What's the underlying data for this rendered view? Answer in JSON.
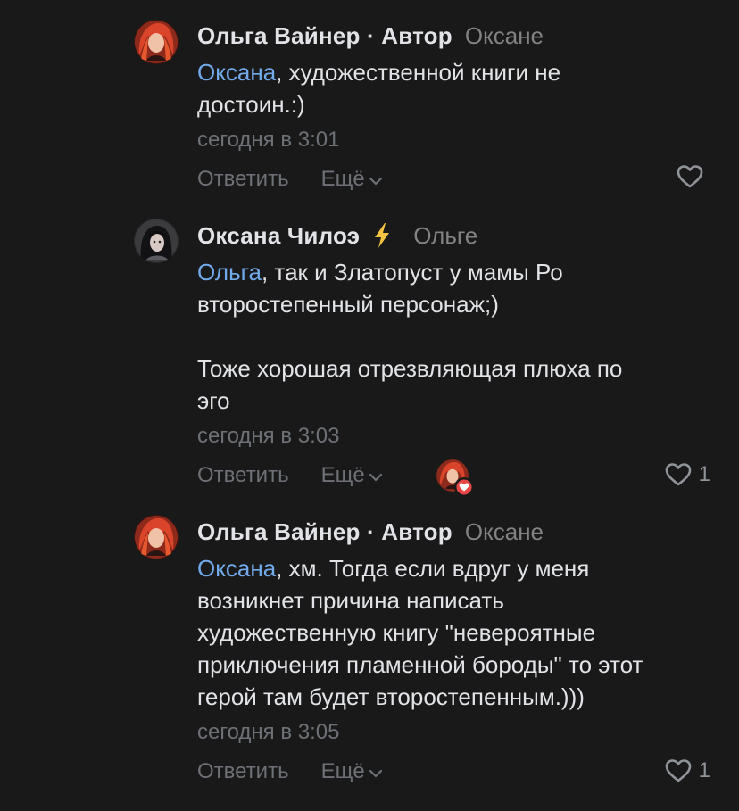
{
  "comments": [
    {
      "author": "Ольга Вайнер · Автор",
      "reply_to": "Оксане",
      "mention": "Оксана",
      "text_lines": [
        ", художественной книги не",
        "достоин.:)"
      ],
      "date": "сегодня в 3:01",
      "reply_label": "Ответить",
      "more_label": "Ещё",
      "likes": ""
    },
    {
      "author": "Оксана Чилоэ",
      "reply_to": "Ольге",
      "mention": "Ольга",
      "text_lines": [
        ", так и Златопуст у мамы Ро",
        "второстепенный персонаж;)"
      ],
      "paragraph2_lines": [
        "Тоже хорошая отрезвляющая плюха по",
        "эго"
      ],
      "date": "сегодня в 3:03",
      "reply_label": "Ответить",
      "more_label": "Ещё",
      "likes": "1"
    },
    {
      "author": "Ольга Вайнер · Автор",
      "reply_to": "Оксане",
      "mention": "Оксана",
      "text_lines": [
        ", хм. Тогда если вдруг у меня",
        "возникнет причина написать",
        "художественную книгу \"невероятные",
        "приключения пламенной бороды\" то этот",
        "герой там будет второстепенным.)))"
      ],
      "date": "сегодня в 3:05",
      "reply_label": "Ответить",
      "more_label": "Ещё",
      "likes": "1"
    }
  ],
  "colors": {
    "background": "#19191a",
    "text": "#e1e3e6",
    "secondary": "#828282",
    "meta": "#6d7175",
    "link": "#71aaeb",
    "bolt": "#f5c242",
    "badge_heart": "#e64646"
  },
  "icons": {
    "like": "heart-outline-icon",
    "more": "chevron-down-icon",
    "verified": "lightning-icon",
    "liked_badge": "heart-filled-icon"
  }
}
